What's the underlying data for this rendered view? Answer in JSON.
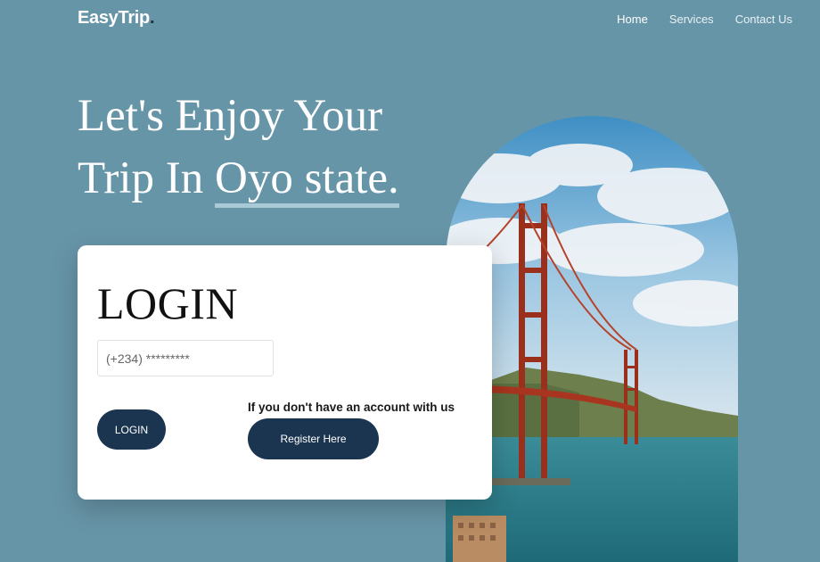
{
  "brand": {
    "name": "EasyTrip",
    "dot": "."
  },
  "nav": [
    {
      "label": "Home",
      "active": true
    },
    {
      "label": "Services",
      "active": false
    },
    {
      "label": "Contact Us",
      "active": false
    }
  ],
  "hero": {
    "line1": "Let's Enjoy Your",
    "line2_prefix": "Trip In ",
    "line2_highlight": "Oyo state."
  },
  "login_card": {
    "title": "LOGIN",
    "phone_placeholder": "(+234) *********",
    "login_button": "LOGIN",
    "register_note": "If you don't have an account with us",
    "register_button": "Register Here"
  },
  "colors": {
    "background": "#6795a8",
    "button": "#1b3550",
    "highlight_underline": "#a9c9d6"
  }
}
